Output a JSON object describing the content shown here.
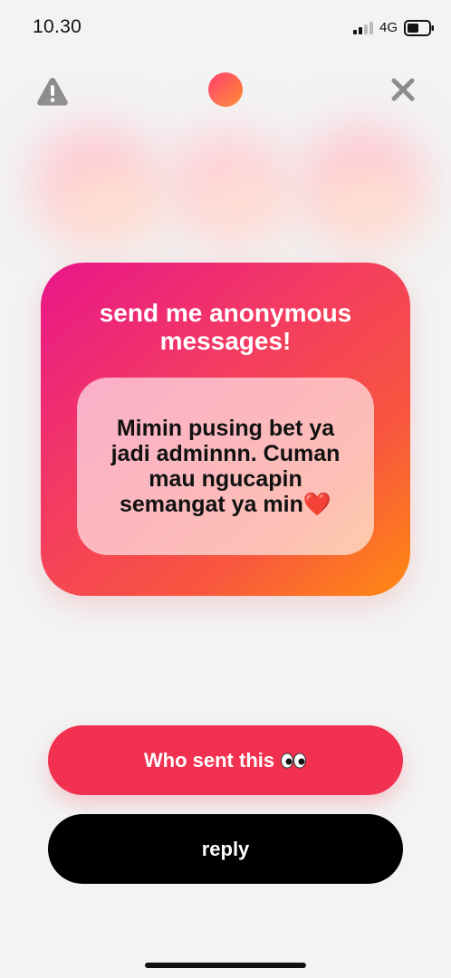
{
  "status_bar": {
    "time": "10.30",
    "network": "4G"
  },
  "header": {
    "warning_icon": "warning-icon",
    "close_icon": "close-icon"
  },
  "card": {
    "title": "send me anonymous messages!",
    "message": "Mimin pusing bet ya jadi adminnn. Cuman mau ngucapin semangat ya min❤️"
  },
  "buttons": {
    "who_sent": "Who sent this",
    "reply": "reply"
  },
  "colors": {
    "accent": "#f2304f",
    "card_start": "#e8168a",
    "card_end": "#ff8a12"
  }
}
